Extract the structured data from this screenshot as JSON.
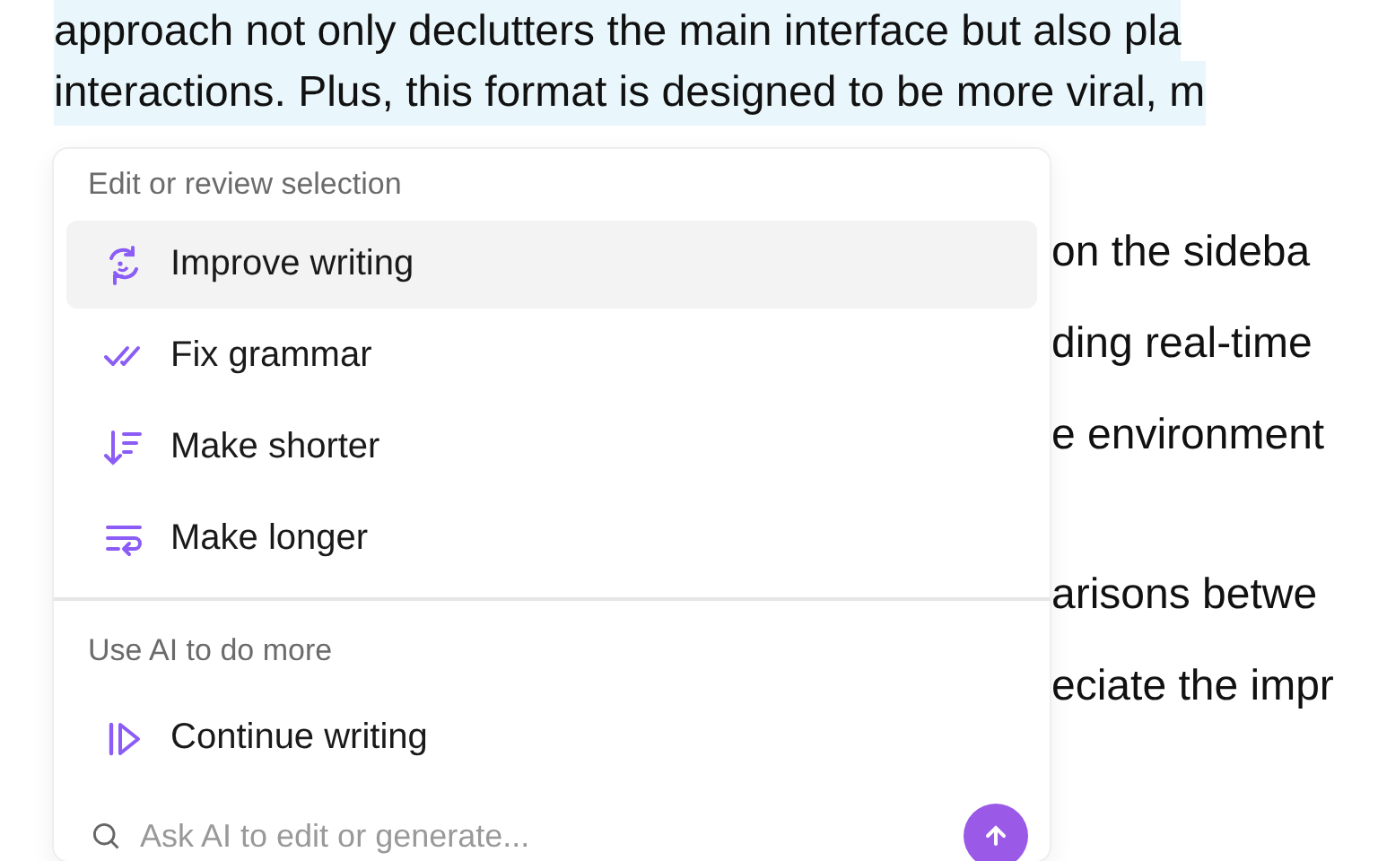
{
  "document": {
    "selected_lines": [
      "approach not only declutters the main interface but also pla",
      "interactions. Plus, this format is designed to be more viral, m"
    ],
    "paragraphs": [
      [
        "on the sideba",
        "ding real-time",
        "e environment"
      ],
      [
        "arisons betwe",
        "eciate the impr"
      ]
    ]
  },
  "menu": {
    "sections": [
      {
        "heading": "Edit or review selection",
        "items": [
          {
            "label": "Improve writing",
            "kind": "improve",
            "selected": true
          },
          {
            "label": "Fix grammar",
            "kind": "grammar",
            "selected": false
          },
          {
            "label": "Make shorter",
            "kind": "shorter",
            "selected": false
          },
          {
            "label": "Make longer",
            "kind": "longer",
            "selected": false
          }
        ]
      },
      {
        "heading": "Use AI to do more",
        "items": [
          {
            "label": "Continue writing",
            "kind": "continue",
            "selected": false
          }
        ]
      }
    ],
    "prompt": {
      "placeholder": "Ask AI to edit or generate..."
    }
  }
}
